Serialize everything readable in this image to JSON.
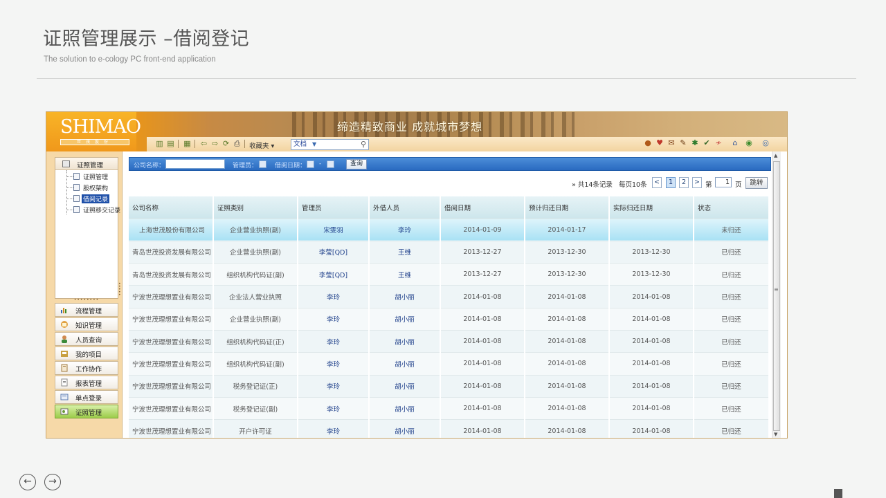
{
  "slide": {
    "title": "证照管理展示 –借阅登记",
    "subtitle": "The solution to e-cology PC front-end application"
  },
  "banner": {
    "logo_text": "SHIMAO",
    "logo_sub": "世茂股份",
    "slogan": "缔造精致商业  成就城市梦想"
  },
  "toolbar": {
    "favorites_label": "收藏夹",
    "doc_select_value": "文档"
  },
  "sidebar": {
    "panel_title": "证照管理",
    "tree": [
      {
        "label": "证照管理"
      },
      {
        "label": "股权架构"
      },
      {
        "label": "借阅记录"
      },
      {
        "label": "证照移交记录"
      }
    ],
    "menu": [
      {
        "label": "流程管理",
        "icon": "flow-chart-icon"
      },
      {
        "label": "知识管理",
        "icon": "knowledge-icon"
      },
      {
        "label": "人员查询",
        "icon": "person-icon"
      },
      {
        "label": "我的项目",
        "icon": "project-icon"
      },
      {
        "label": "工作协作",
        "icon": "clipboard-icon"
      },
      {
        "label": "报表管理",
        "icon": "report-icon"
      },
      {
        "label": "单点登录",
        "icon": "login-icon"
      },
      {
        "label": "证照管理",
        "icon": "certificate-icon"
      }
    ],
    "powered": "powered",
    "expand_glyph": "»"
  },
  "search": {
    "company_label": "公司名称：",
    "manager_label": "管理员：",
    "borrow_date_label": "借阅日期：",
    "date_sep": "-",
    "query_button": "查询"
  },
  "pager": {
    "total_text": "» 共14条记录",
    "per_page_text": "每页10条",
    "prev": "<",
    "pages": [
      "1",
      "2"
    ],
    "next": ">",
    "goto_prefix": "第",
    "goto_value": "1",
    "goto_suffix": "页",
    "go_button": "跳转"
  },
  "table": {
    "columns": [
      "公司名称",
      "证照类别",
      "管理员",
      "外借人员",
      "借阅日期",
      "预计归还日期",
      "实际归还日期",
      "状态"
    ],
    "rows": [
      [
        "上海世茂股份有限公司",
        "企业营业执照(副)",
        "宋雯羽",
        "李玲",
        "2014-01-09",
        "2014-01-17",
        "",
        "未归还"
      ],
      [
        "青岛世茂投资发展有限公司",
        "企业营业执照(副)",
        "李莹[QD]",
        "王维",
        "2013-12-27",
        "2013-12-30",
        "2013-12-30",
        "已归还"
      ],
      [
        "青岛世茂投资发展有限公司",
        "组织机构代码证(副)",
        "李莹[QD]",
        "王维",
        "2013-12-27",
        "2013-12-30",
        "2013-12-30",
        "已归还"
      ],
      [
        "宁波世茂理想置业有限公司",
        "企业法人营业执照",
        "李玲",
        "胡小丽",
        "2014-01-08",
        "2014-01-08",
        "2014-01-08",
        "已归还"
      ],
      [
        "宁波世茂理想置业有限公司",
        "企业营业执照(副)",
        "李玲",
        "胡小丽",
        "2014-01-08",
        "2014-01-08",
        "2014-01-08",
        "已归还"
      ],
      [
        "宁波世茂理想置业有限公司",
        "组织机构代码证(正)",
        "李玲",
        "胡小丽",
        "2014-01-08",
        "2014-01-08",
        "2014-01-08",
        "已归还"
      ],
      [
        "宁波世茂理想置业有限公司",
        "组织机构代码证(副)",
        "李玲",
        "胡小丽",
        "2014-01-08",
        "2014-01-08",
        "2014-01-08",
        "已归还"
      ],
      [
        "宁波世茂理想置业有限公司",
        "税务登记证(正)",
        "李玲",
        "胡小丽",
        "2014-01-08",
        "2014-01-08",
        "2014-01-08",
        "已归还"
      ],
      [
        "宁波世茂理想置业有限公司",
        "税务登记证(副)",
        "李玲",
        "胡小丽",
        "2014-01-08",
        "2014-01-08",
        "2014-01-08",
        "已归还"
      ],
      [
        "宁波世茂理想置业有限公司",
        "开户许可证",
        "李玲",
        "胡小丽",
        "2014-01-08",
        "2014-01-08",
        "2014-01-08",
        "已归还"
      ]
    ]
  },
  "slide_nav": {
    "prev_glyph": "←",
    "next_glyph": "→"
  }
}
